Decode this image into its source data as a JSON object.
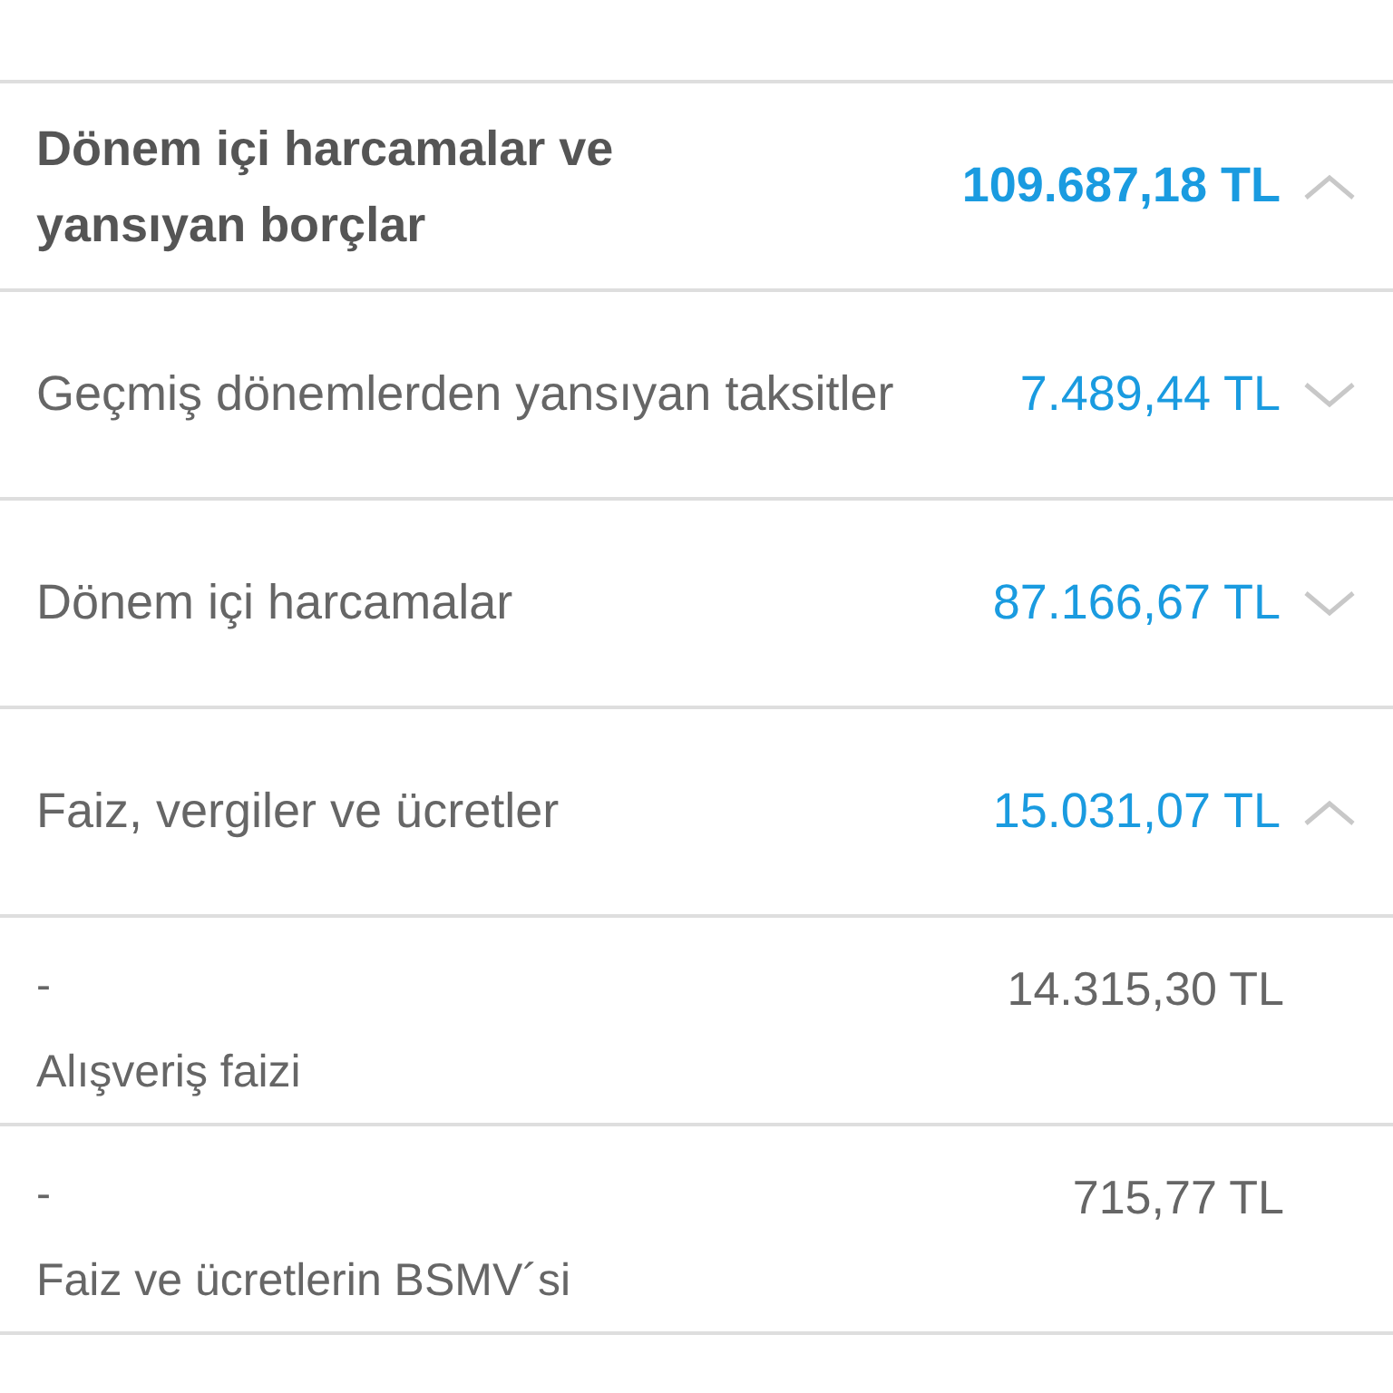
{
  "summary": {
    "title": "Dönem içi harcamalar ve yansıyan borçlar",
    "amount": "109.687,18 TL",
    "expanded": true
  },
  "categories": [
    {
      "label": "Geçmiş dönemlerden yansıyan taksitler",
      "amount": "7.489,44 TL",
      "expanded": false
    },
    {
      "label": "Dönem içi harcamalar",
      "amount": "87.166,67 TL",
      "expanded": false
    },
    {
      "label": "Faiz, vergiler ve ücretler",
      "amount": "15.031,07 TL",
      "expanded": true
    }
  ],
  "details": [
    {
      "marker": "-",
      "amount": "14.315,30 TL",
      "label": "Alışveriş faizi"
    },
    {
      "marker": "-",
      "amount": "715,77 TL",
      "label": "Faiz ve ücretlerin BSMV´si"
    }
  ]
}
